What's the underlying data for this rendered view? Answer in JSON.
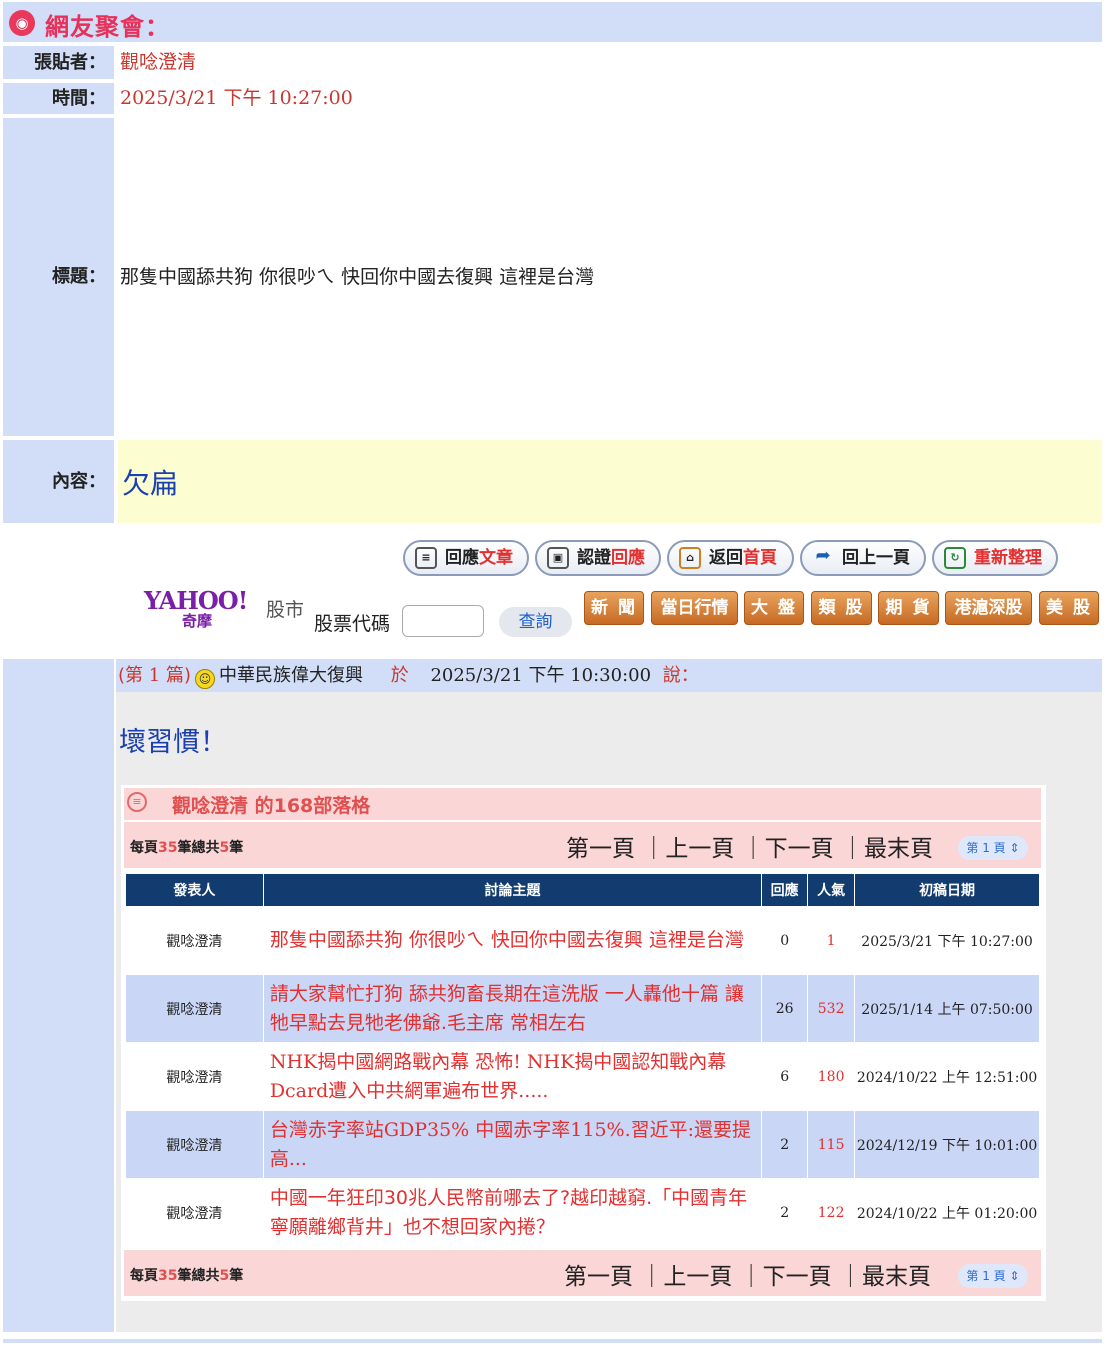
{
  "header": {
    "title": "網友聚會：",
    "icon": "people-icon"
  },
  "post": {
    "poster_label": "張貼者：",
    "poster": "觀唸澄清",
    "time_label": "時間：",
    "time": "2025/3/21 下午 10:27:00",
    "subject_label": "標題：",
    "subject": "那隻中國舔共狗 你很吵ㄟ 快回你中國去復興 這裡是台灣",
    "content_label": "內容：",
    "content": "欠扁"
  },
  "actions": [
    {
      "a": "回應",
      "b": "文章",
      "icon": "document-icon"
    },
    {
      "a": "認證",
      "b": "回應",
      "icon": "lock-icon"
    },
    {
      "a": "返回",
      "b": "首頁",
      "icon": "home-icon"
    },
    {
      "a": "回上一頁",
      "b": "",
      "icon": "back-arrow-icon"
    },
    {
      "a": "",
      "b": "重新整理",
      "icon": "refresh-icon"
    }
  ],
  "stock": {
    "logo_text": "YAHOO!",
    "logo_sub": "奇摩",
    "market": "股市",
    "code_label": "股票代碼",
    "input_value": "",
    "query": "查詢",
    "buttons": [
      "新 聞",
      "當日行情",
      "大 盤",
      "類 股",
      "期 貨",
      "港滬深股",
      "美 股"
    ]
  },
  "reply": {
    "prefix": "(第",
    "num": "1",
    "suffix": "篇)",
    "author": "中華民族偉大復興",
    "at": "於",
    "time": "2025/3/21 下午 10:30:00",
    "said": "說：",
    "body": "壞習慣！"
  },
  "blog": {
    "title": "觀唸澄清 的168部落格",
    "per_page_a": "每頁",
    "per_page_n": "35",
    "per_page_b": "筆總共",
    "total_n": "5",
    "total_b": "筆",
    "pager": {
      "first": "第一頁",
      "prev": "上一頁",
      "next": "下一頁",
      "last": "最末頁",
      "select": "第 1 頁"
    },
    "columns": [
      "發表人",
      "討論主題",
      "回應",
      "人氣",
      "初稿日期"
    ],
    "rows": [
      {
        "author": "觀唸澄清",
        "topic": "那隻中國舔共狗 你很吵ㄟ 快回你中國去復興 這裡是台灣",
        "replies": "0",
        "views": "1",
        "date": "2025/3/21 下午 10:27:00"
      },
      {
        "author": "觀唸澄清",
        "topic": "請大家幫忙打狗 舔共狗畜長期在這洗版 一人轟他十篇 讓牠早點去見牠老佛爺.毛主席 常相左右",
        "replies": "26",
        "views": "532",
        "date": "2025/1/14 上午 07:50:00"
      },
      {
        "author": "觀唸澄清",
        "topic": "NHK揭中國網路戰內幕 恐怖! NHK揭中國認知戰內幕 Dcard遭入中共網軍遍布世界.....",
        "replies": "6",
        "views": "180",
        "date": "2024/10/22 上午 12:51:00"
      },
      {
        "author": "觀唸澄清",
        "topic": "台灣赤字率站GDP35% 中國赤字率115%.習近平:還要提高...",
        "replies": "2",
        "views": "115",
        "date": "2024/12/19 下午 10:01:00"
      },
      {
        "author": "觀唸澄清",
        "topic": "中國一年狂印30兆人民幣前哪去了?越印越窮.「中國青年寧願離鄉背井」也不想回家內捲？",
        "replies": "2",
        "views": "122",
        "date": "2024/10/22 上午 01:20:00"
      }
    ]
  }
}
